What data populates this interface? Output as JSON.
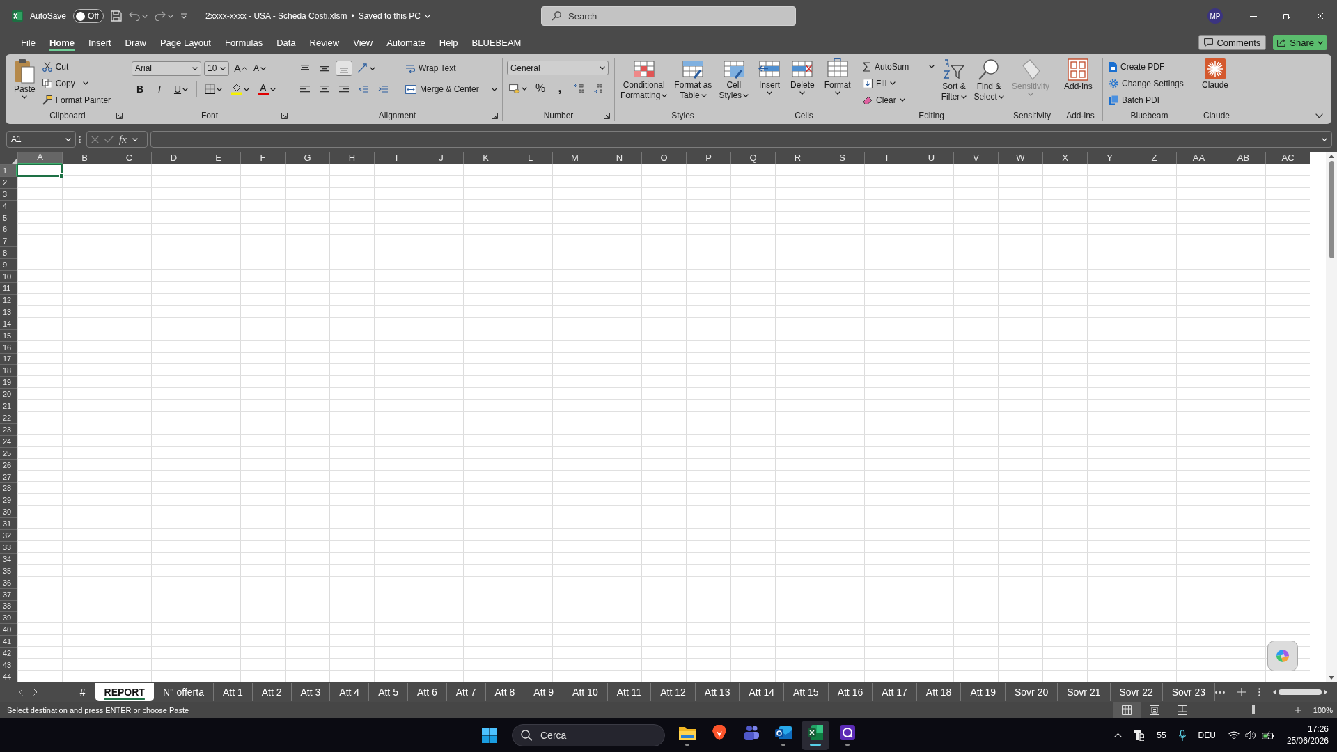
{
  "title_bar": {
    "autosave_label": "AutoSave",
    "autosave": {
      "label": "Off",
      "on": false
    },
    "file_name": "2xxxx-xxxx - USA - Scheda Costi.xlsm",
    "separator": "•",
    "save_status": "Saved to this PC",
    "search": {
      "placeholder": "Search"
    },
    "avatar": "MP"
  },
  "menu_tabs": [
    {
      "label": "File",
      "selected": false
    },
    {
      "label": "Home",
      "selected": true
    },
    {
      "label": "Insert",
      "selected": false
    },
    {
      "label": "Draw",
      "selected": false
    },
    {
      "label": "Page Layout",
      "selected": false
    },
    {
      "label": "Formulas",
      "selected": false
    },
    {
      "label": "Data",
      "selected": false
    },
    {
      "label": "Review",
      "selected": false
    },
    {
      "label": "View",
      "selected": false
    },
    {
      "label": "Automate",
      "selected": false
    },
    {
      "label": "Help",
      "selected": false
    },
    {
      "label": "BLUEBEAM",
      "selected": false
    }
  ],
  "comments_button": "Comments",
  "share_button": "Share",
  "ribbon": {
    "groups": [
      {
        "kind": "clipboard",
        "label": "Clipboard",
        "paste": "Paste",
        "cut": "Cut",
        "copy": "Copy",
        "format_painter": "Format Painter"
      },
      {
        "kind": "font",
        "label": "Font",
        "font_name": "Arial",
        "font_size": "10",
        "grow": "A",
        "shrink": "A",
        "bold": "B",
        "italic": "I",
        "underline": "U",
        "font_color": "A"
      },
      {
        "kind": "alignment",
        "label": "Alignment",
        "align_buttons": [
          {
            "kind": "top",
            "selected": false
          },
          {
            "kind": "middle",
            "selected": false
          },
          {
            "kind": "bottom",
            "selected": true
          }
        ],
        "wrap_text": "Wrap Text",
        "merge_center": "Merge & Center"
      },
      {
        "kind": "number",
        "label": "Number",
        "format": "General",
        "percent": "%",
        "comma": ","
      },
      {
        "kind": "styles",
        "label": "Styles",
        "buttons": [
          {
            "kind": "conditional",
            "lines": [
              "Conditional",
              "Formatting"
            ]
          },
          {
            "kind": "table",
            "lines": [
              "Format as",
              "Table"
            ]
          },
          {
            "kind": "cell_styles",
            "lines": [
              "Cell",
              "Styles"
            ]
          }
        ]
      },
      {
        "kind": "cells",
        "label": "Cells",
        "buttons": [
          {
            "kind": "insert",
            "label": "Insert"
          },
          {
            "kind": "delete",
            "label": "Delete"
          },
          {
            "kind": "format",
            "label": "Format"
          }
        ]
      },
      {
        "kind": "editing",
        "label": "Editing",
        "autosum": "AutoSum",
        "fill": "Fill",
        "clear": "Clear",
        "sort_filter": [
          "Sort &",
          "Filter"
        ],
        "find_select": [
          "Find &",
          "Select"
        ]
      },
      {
        "kind": "sensitivity",
        "label": "Sensitivity",
        "button": "Sensitivity",
        "disabled": true
      },
      {
        "kind": "addins",
        "label": "Add-ins",
        "button": "Add-ins"
      },
      {
        "kind": "bluebeam",
        "label": "Bluebeam",
        "items": [
          "Create PDF",
          "Change Settings",
          "Batch PDF"
        ]
      },
      {
        "kind": "claude",
        "label": "Claude",
        "button": "Claude"
      }
    ]
  },
  "formula_bar": {
    "name_box": "A1",
    "fx": "fx"
  },
  "grid": {
    "columns": [
      {
        "label": "A",
        "selected": true
      },
      {
        "label": "B",
        "selected": false
      },
      {
        "label": "C",
        "selected": false
      },
      {
        "label": "D",
        "selected": false
      },
      {
        "label": "E",
        "selected": false
      },
      {
        "label": "F",
        "selected": false
      },
      {
        "label": "G",
        "selected": false
      },
      {
        "label": "H",
        "selected": false
      },
      {
        "label": "I",
        "selected": false
      },
      {
        "label": "J",
        "selected": false
      },
      {
        "label": "K",
        "selected": false
      },
      {
        "label": "L",
        "selected": false
      },
      {
        "label": "M",
        "selected": false
      },
      {
        "label": "N",
        "selected": false
      },
      {
        "label": "O",
        "selected": false
      },
      {
        "label": "P",
        "selected": false
      },
      {
        "label": "Q",
        "selected": false
      },
      {
        "label": "R",
        "selected": false
      },
      {
        "label": "S",
        "selected": false
      },
      {
        "label": "T",
        "selected": false
      },
      {
        "label": "U",
        "selected": false
      },
      {
        "label": "V",
        "selected": false
      },
      {
        "label": "W",
        "selected": false
      },
      {
        "label": "X",
        "selected": false
      },
      {
        "label": "Y",
        "selected": false
      },
      {
        "label": "Z",
        "selected": false
      },
      {
        "label": "AA",
        "selected": false
      },
      {
        "label": "AB",
        "selected": false
      },
      {
        "label": "AC",
        "selected": false
      }
    ],
    "rows": [
      {
        "label": "1",
        "selected": true
      },
      {
        "label": "2",
        "selected": false
      },
      {
        "label": "3",
        "selected": false
      },
      {
        "label": "4",
        "selected": false
      },
      {
        "label": "5",
        "selected": false
      },
      {
        "label": "6",
        "selected": false
      },
      {
        "label": "7",
        "selected": false
      },
      {
        "label": "8",
        "selected": false
      },
      {
        "label": "9",
        "selected": false
      },
      {
        "label": "10",
        "selected": false
      },
      {
        "label": "11",
        "selected": false
      },
      {
        "label": "12",
        "selected": false
      },
      {
        "label": "13",
        "selected": false
      },
      {
        "label": "14",
        "selected": false
      },
      {
        "label": "15",
        "selected": false
      },
      {
        "label": "16",
        "selected": false
      },
      {
        "label": "17",
        "selected": false
      },
      {
        "label": "18",
        "selected": false
      },
      {
        "label": "19",
        "selected": false
      },
      {
        "label": "20",
        "selected": false
      },
      {
        "label": "21",
        "selected": false
      },
      {
        "label": "22",
        "selected": false
      },
      {
        "label": "23",
        "selected": false
      },
      {
        "label": "24",
        "selected": false
      },
      {
        "label": "25",
        "selected": false
      },
      {
        "label": "26",
        "selected": false
      },
      {
        "label": "27",
        "selected": false
      },
      {
        "label": "28",
        "selected": false
      },
      {
        "label": "29",
        "selected": false
      },
      {
        "label": "30",
        "selected": false
      },
      {
        "label": "31",
        "selected": false
      },
      {
        "label": "32",
        "selected": false
      },
      {
        "label": "33",
        "selected": false
      },
      {
        "label": "34",
        "selected": false
      },
      {
        "label": "35",
        "selected": false
      },
      {
        "label": "36",
        "selected": false
      },
      {
        "label": "37",
        "selected": false
      },
      {
        "label": "38",
        "selected": false
      },
      {
        "label": "39",
        "selected": false
      },
      {
        "label": "40",
        "selected": false
      },
      {
        "label": "41",
        "selected": false
      },
      {
        "label": "42",
        "selected": false
      },
      {
        "label": "43",
        "selected": false
      },
      {
        "label": "44",
        "selected": false
      }
    ]
  },
  "sheet_tabs": [
    {
      "label": "#",
      "selected": false
    },
    {
      "label": "REPORT",
      "selected": true
    },
    {
      "label": "N° offerta",
      "selected": false
    },
    {
      "label": "Att 1",
      "selected": false
    },
    {
      "label": "Att 2",
      "selected": false
    },
    {
      "label": "Att 3",
      "selected": false
    },
    {
      "label": "Att 4",
      "selected": false
    },
    {
      "label": "Att 5",
      "selected": false
    },
    {
      "label": "Att 6",
      "selected": false
    },
    {
      "label": "Att 7",
      "selected": false
    },
    {
      "label": "Att 8",
      "selected": false
    },
    {
      "label": "Att 9",
      "selected": false
    },
    {
      "label": "Att 10",
      "selected": false
    },
    {
      "label": "Att 11",
      "selected": false
    },
    {
      "label": "Att 12",
      "selected": false
    },
    {
      "label": "Att 13",
      "selected": false
    },
    {
      "label": "Att 14",
      "selected": false
    },
    {
      "label": "Att 15",
      "selected": false
    },
    {
      "label": "Att 16",
      "selected": false
    },
    {
      "label": "Att 17",
      "selected": false
    },
    {
      "label": "Att 18",
      "selected": false
    },
    {
      "label": "Att 19",
      "selected": false
    },
    {
      "label": "Sovr 20",
      "selected": false
    },
    {
      "label": "Sovr 21",
      "selected": false
    },
    {
      "label": "Sovr 22",
      "selected": false
    },
    {
      "label": "Sovr 23",
      "selected": false
    }
  ],
  "status_bar": {
    "message": "Select destination and press ENTER or choose Paste",
    "views": [
      {
        "kind": "normal",
        "selected": true
      },
      {
        "kind": "page_layout",
        "selected": false
      },
      {
        "kind": "page_break",
        "selected": false
      }
    ],
    "zoom": {
      "level": 0.5,
      "label": "100%"
    }
  },
  "taskbar": {
    "search": {
      "placeholder": "Cerca"
    },
    "apps": [
      {
        "kind": "explorer",
        "running": true,
        "selected": false
      },
      {
        "kind": "brave",
        "running": false,
        "selected": false
      },
      {
        "kind": "teams",
        "running": false,
        "selected": false
      },
      {
        "kind": "outlook",
        "running": true,
        "selected": false
      },
      {
        "kind": "excel",
        "running": true,
        "selected": true
      },
      {
        "kind": "app",
        "running": true,
        "selected": false
      }
    ],
    "tray": {
      "count": "55",
      "language": "DEU",
      "time": "17:26",
      "date": "25/06/2026"
    }
  }
}
